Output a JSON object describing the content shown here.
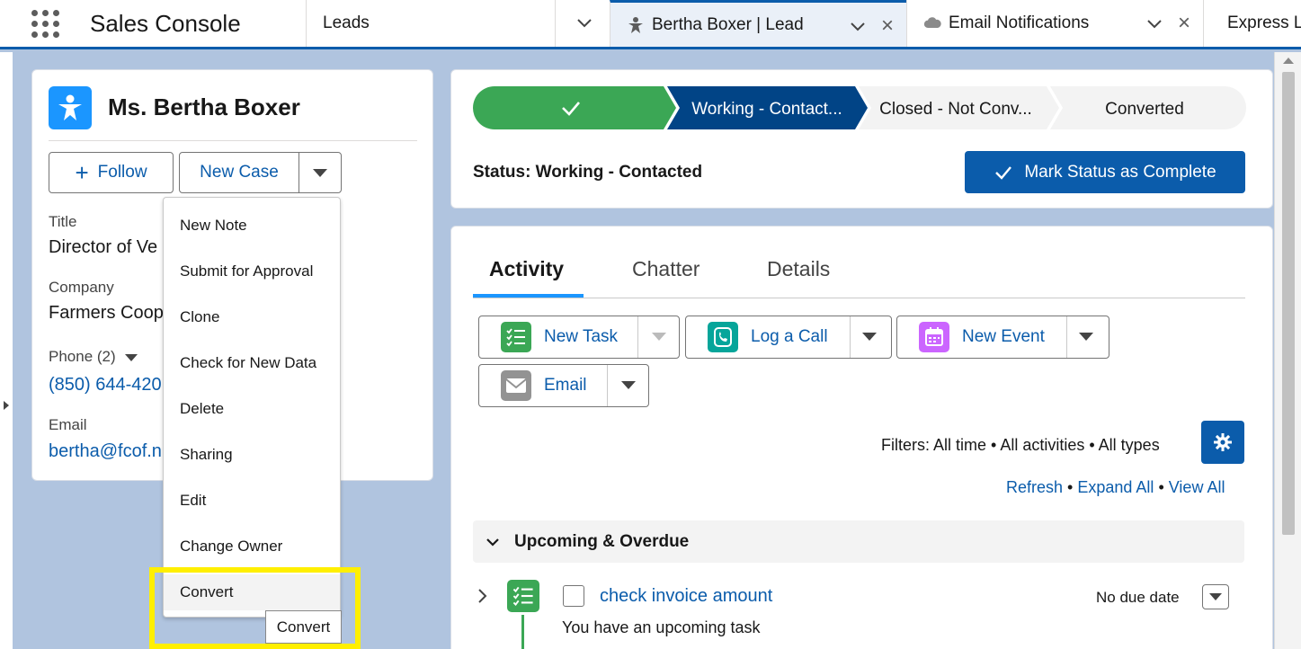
{
  "nav": {
    "app_name": "Sales Console",
    "tabs": [
      {
        "label": "Leads"
      },
      {
        "label": "Bertha Boxer | Lead"
      },
      {
        "label": "Email Notifications"
      },
      {
        "label": "Express Logisti"
      }
    ]
  },
  "lead": {
    "name": "Ms. Bertha Boxer",
    "follow_label": "Follow",
    "new_case_label": "New Case",
    "fields": [
      {
        "label": "Title",
        "value": "Director of Ve"
      },
      {
        "label": "Company",
        "value": "Farmers Coop"
      },
      {
        "label": "Phone (2)",
        "value": "(850) 644-420"
      },
      {
        "label": "Email",
        "value": "bertha@fcof.n"
      }
    ]
  },
  "menu": {
    "items": [
      "New Note",
      "Submit for Approval",
      "Clone",
      "Check for New Data",
      "Delete",
      "Sharing",
      "Edit",
      "Change Owner",
      "Convert"
    ],
    "tooltip": "Convert"
  },
  "path": {
    "stages": [
      "",
      "Working - Contact...",
      "Closed - Not Conv...",
      "Converted"
    ],
    "status_text": "Status: Working - Contacted",
    "mark_button": "Mark Status as Complete"
  },
  "activity": {
    "tabs": [
      "Activity",
      "Chatter",
      "Details"
    ],
    "buttons": [
      "New Task",
      "Log a Call",
      "New Event",
      "Email"
    ],
    "filters": "Filters: All time • All activities • All types",
    "links": [
      "Refresh",
      "Expand All",
      "View All"
    ],
    "section": "Upcoming & Overdue",
    "task_title": "check invoice amount",
    "task_sub": "You have an upcoming task",
    "due": "No due date"
  },
  "colors": {
    "brand": "#0b5cab",
    "path_done": "#3ba755",
    "path_current": "#014486",
    "highlight": "#ffef00"
  }
}
